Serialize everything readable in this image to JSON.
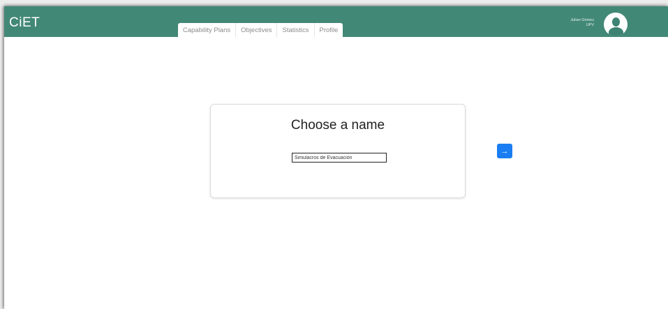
{
  "app": {
    "brand": "CiET"
  },
  "nav": {
    "tabs": [
      {
        "label": "Capability Plans"
      },
      {
        "label": "Objectives"
      },
      {
        "label": "Statistics"
      },
      {
        "label": "Profile"
      }
    ]
  },
  "user": {
    "name": "Julian Gómez",
    "org": "UPV"
  },
  "form": {
    "title": "Choose a name",
    "name_value": "Simulacros de Evacuación",
    "next_icon": "→"
  },
  "colors": {
    "header": "#428877",
    "primary_button": "#1a7ef2"
  },
  "icons": {
    "avatar": "user-avatar-icon",
    "next": "arrow-right-icon"
  }
}
